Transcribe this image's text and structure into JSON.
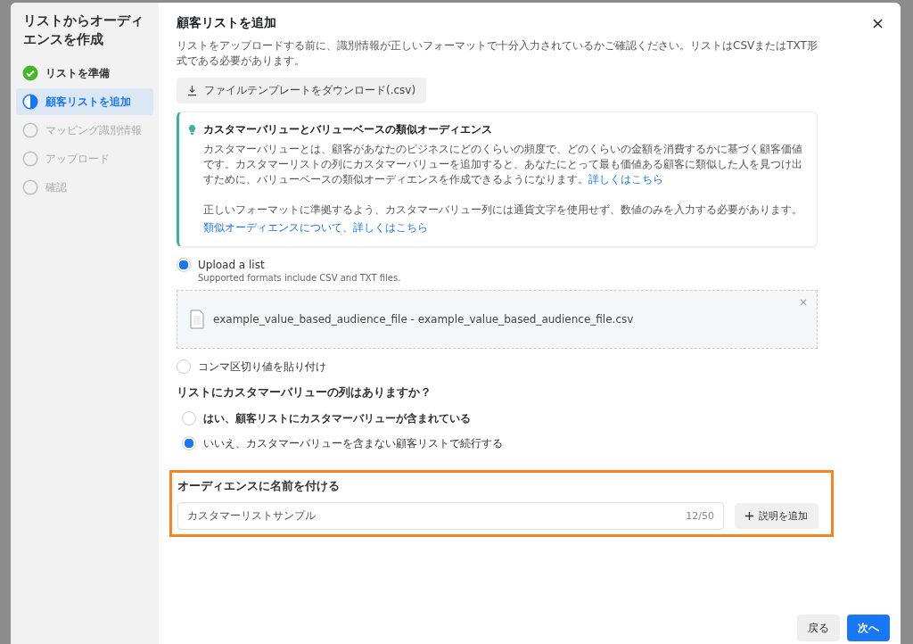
{
  "sidebar": {
    "title": "リストからオーディエンスを作成",
    "steps": [
      {
        "label": "リストを準備",
        "kind": "done",
        "selected": false
      },
      {
        "label": "顧客リストを追加",
        "kind": "current",
        "selected": true
      },
      {
        "label": "マッピング識別情報",
        "kind": "todo",
        "selected": false
      },
      {
        "label": "アップロード",
        "kind": "todo",
        "selected": false
      },
      {
        "label": "確認",
        "kind": "todo",
        "selected": false
      }
    ]
  },
  "dialog": {
    "title": "顧客リストを追加",
    "intro": "リストをアップロードする前に、識別情報が正しいフォーマットで十分入力されているかご確認ください。リストはCSVまたはTXT形式である必要があります。",
    "download_button": "ファイルテンプレートをダウンロード(.csv)"
  },
  "tip": {
    "title": "カスタマーバリューとバリューベースの類似オーディエンス",
    "body": "カスタマーバリューとは、顧客があなたのビジネスにどのくらいの頻度で、どのくらいの金額を消費するかに基づく顧客価値です。カスタマーリストの列にカスタマーバリューを追加すると、あなたにとって最も価値ある顧客に類似した人を見つけ出すために、バリューベースの類似オーディエンスを作成できるようになります。",
    "body_link": "詳しくはこちら",
    "note": "正しいフォーマットに準拠するよう、カスタマーバリュー列には通貨文字を使用せず、数値のみを入力する必要があります。",
    "note_link": "類似オーディエンスについて、詳しくはこちら"
  },
  "upload_options": [
    {
      "label": "Upload a list",
      "hint": "Supported formats include CSV and TXT files.",
      "selected": true,
      "file": "example_value_based_audience_file - example_value_based_audience_file.csv",
      "remove": "×"
    },
    {
      "label": "コンマ区切り値を貼り付け",
      "selected": false
    }
  ],
  "question": {
    "title": "リストにカスタマーバリューの列はありますか？",
    "options": [
      {
        "label": "はい、顧客リストにカスタマーバリューが含まれている",
        "selected": false,
        "bold": true
      },
      {
        "label": "いいえ、カスタマーバリューを含まない顧客リストで続行する",
        "selected": true,
        "bold": false
      }
    ]
  },
  "name_section": {
    "highlighted": true,
    "title": "オーディエンスに名前を付ける",
    "value": "カスタマーリストサンプル",
    "counter": "12/50",
    "add_button": "説明を追加"
  },
  "footer": {
    "back": "戻る",
    "next": "次へ"
  }
}
